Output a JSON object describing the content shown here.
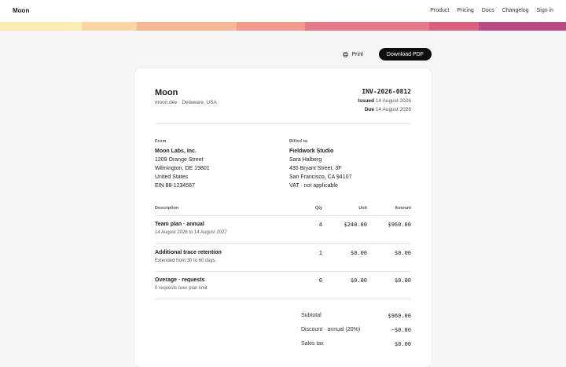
{
  "nav": {
    "brand": "Moon",
    "links": [
      "Product",
      "Pricing",
      "Docs",
      "Changelog",
      "Sign in"
    ]
  },
  "stripe_colors": [
    "#fdefb4",
    "#fbd7a4",
    "#f5b894",
    "#f39a8f",
    "#e67a8b",
    "#d9617f",
    "#b84b82"
  ],
  "actions": {
    "print": "Print",
    "download": "Download PDF"
  },
  "invoice": {
    "vendor_name": "Moon",
    "vendor_sub": "moon.dev · Delaware, USA",
    "number": "INV-2026-0812",
    "issued_label": "Issued",
    "issued_date": "14 August 2026",
    "due_label": "Due",
    "due_date": "14 August 2026",
    "from": {
      "label": "From",
      "name": "Moon Labs, Inc.",
      "lines": [
        "1209 Orange Street",
        "Wilmington, DE 19801",
        "United States",
        "EIN 88-1234567"
      ]
    },
    "billed_to": {
      "label": "Billed to",
      "name": "Fieldwork Studio",
      "lines": [
        "Sara Halberg",
        "435 Bryant Street, 3F",
        "San Francisco, CA 94107",
        "VAT · not applicable"
      ]
    },
    "columns": {
      "description": "Description",
      "qty": "Qty",
      "unit": "Unit",
      "amount": "Amount"
    },
    "items": [
      {
        "title": "Team plan · annual",
        "sub": "14 August 2026 to 14 August 2027",
        "qty": "4",
        "unit": "$240.00",
        "amount": "$960.00"
      },
      {
        "title": "Additional trace retention",
        "sub": "Extended from 30 to 60 days",
        "qty": "1",
        "unit": "$0.00",
        "amount": "$0.00"
      },
      {
        "title": "Overage · requests",
        "sub": "0 requests over plan limit",
        "qty": "0",
        "unit": "$0.00",
        "amount": "$0.00"
      }
    ],
    "totals": [
      {
        "label": "Subtotal",
        "value": "$960.00"
      },
      {
        "label": "Discount · annual (20%)",
        "value": "−$0.00"
      },
      {
        "label": "Sales tax",
        "value": "$0.00"
      }
    ]
  }
}
